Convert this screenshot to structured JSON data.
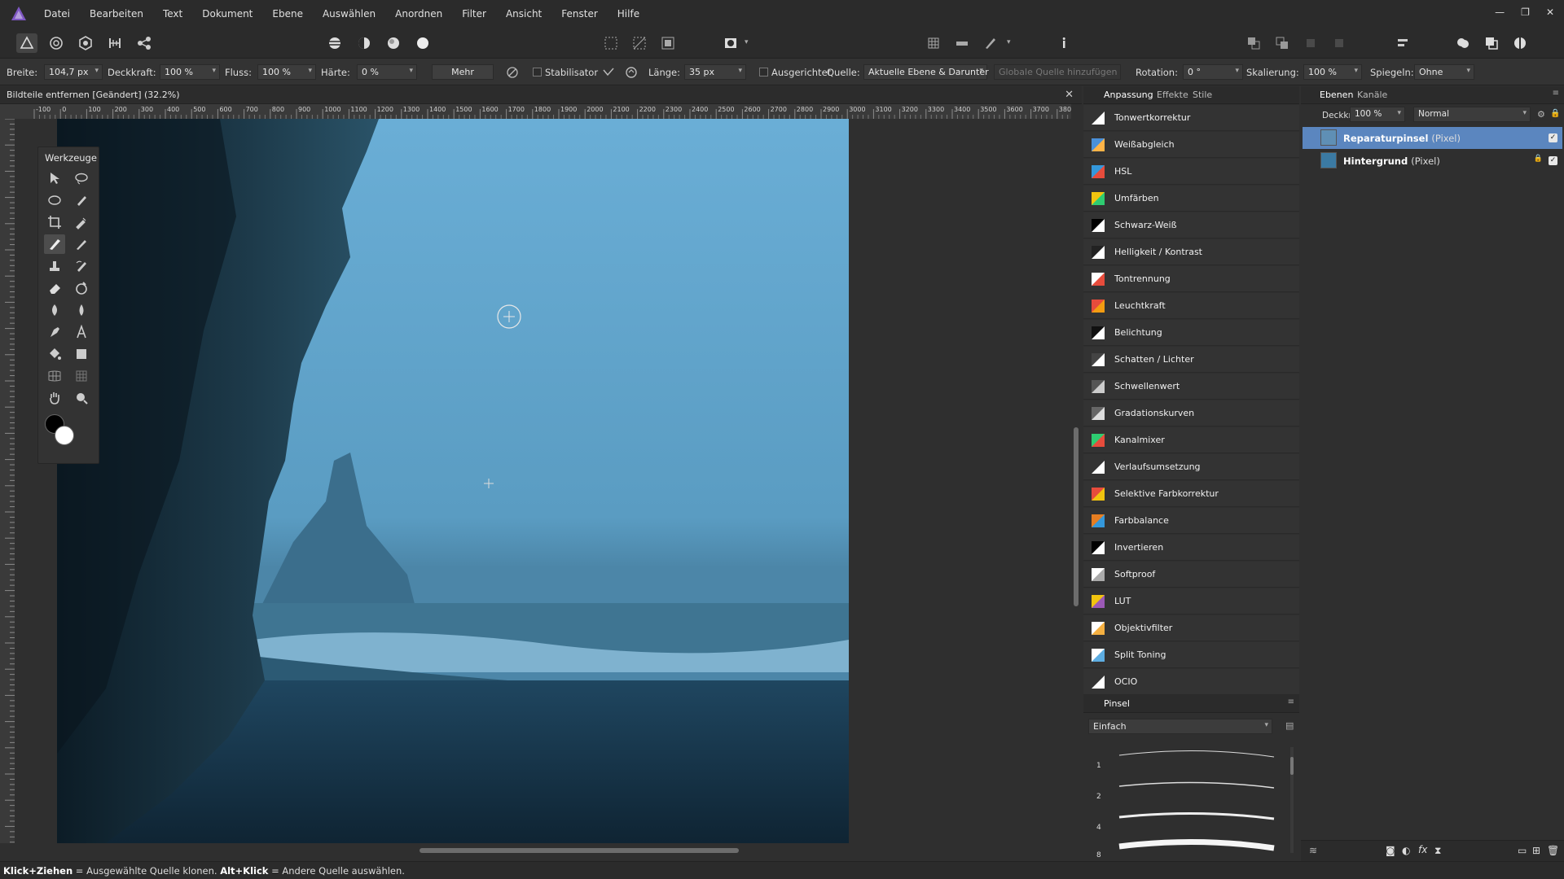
{
  "app": {
    "name": "Affinity Photo",
    "accent": "#7e57c2"
  },
  "menu": [
    "Datei",
    "Bearbeiten",
    "Text",
    "Dokument",
    "Ebene",
    "Auswählen",
    "Anordnen",
    "Filter",
    "Ansicht",
    "Fenster",
    "Hilfe"
  ],
  "context": {
    "breite_label": "Breite:",
    "breite_value": "104,7 px",
    "deckkraft_label": "Deckkraft:",
    "deckkraft_value": "100 %",
    "fluss_label": "Fluss:",
    "fluss_value": "100 %",
    "haerte_label": "Härte:",
    "haerte_value": "0 %",
    "mehr_label": "Mehr",
    "stabilisator_label": "Stabilisator",
    "laenge_label": "Länge:",
    "laenge_value": "35 px",
    "ausgerichtet_label": "Ausgerichtet",
    "quelle_label": "Quelle:",
    "quelle_value": "Aktuelle Ebene & Darunter",
    "globale_quelle_label": "Globale Quelle hinzufügen",
    "rotation_label": "Rotation:",
    "rotation_value": "0 °",
    "skalierung_label": "Skalierung:",
    "skalierung_value": "100 %",
    "spiegeln_label": "Spiegeln:",
    "spiegeln_value": "Ohne"
  },
  "document": {
    "tab_title": "Bildteile entfernen [Geändert] (32.2%)"
  },
  "ruler": {
    "h_ticks": [
      "-100",
      "0",
      "100",
      "200",
      "300",
      "400",
      "500",
      "600",
      "700",
      "800",
      "900",
      "1000",
      "1100",
      "1200",
      "1300",
      "1400",
      "1500",
      "1600",
      "1700",
      "1800",
      "1900",
      "2000",
      "2100",
      "2200",
      "2300",
      "2400",
      "2500",
      "2600",
      "2700",
      "2800",
      "2900",
      "3000",
      "3100",
      "3200",
      "3300",
      "3400",
      "3500",
      "3600",
      "3700",
      "3800"
    ]
  },
  "tools_panel": {
    "title": "Werkzeuge"
  },
  "status": {
    "part1_bold": "Klick+Ziehen",
    "part1": " = Ausgewählte Quelle klonen. ",
    "part2_bold": "Alt+Klick",
    "part2": " = Andere Quelle auswählen."
  },
  "adjustments": {
    "tabs": [
      "Anpassung",
      "Effekte",
      "Stile"
    ],
    "items": [
      "Tonwertkorrektur",
      "Weißabgleich",
      "HSL",
      "Umfärben",
      "Schwarz-Weiß",
      "Helligkeit / Kontrast",
      "Tontrennung",
      "Leuchtkraft",
      "Belichtung",
      "Schatten / Lichter",
      "Schwellenwert",
      "Gradationskurven",
      "Kanalmixer",
      "Verlaufsumsetzung",
      "Selektive Farbkorrektur",
      "Farbbalance",
      "Invertieren",
      "Softproof",
      "LUT",
      "Objektivfilter",
      "Split Toning",
      "OCIO"
    ]
  },
  "brush": {
    "tab": "Pinsel",
    "category": "Einfach",
    "sizes": [
      "1",
      "2",
      "4",
      "8"
    ]
  },
  "layers": {
    "tabs": [
      "Ebenen",
      "Kanäle"
    ],
    "opacity_label": "Deckkraft:",
    "opacity_value": "100 %",
    "blend_mode": "Normal",
    "items": [
      {
        "name": "Reparaturpinsel",
        "type": "(Pixel)",
        "selected": true
      },
      {
        "name": "Hintergrund",
        "type": "(Pixel)",
        "selected": false
      }
    ]
  }
}
